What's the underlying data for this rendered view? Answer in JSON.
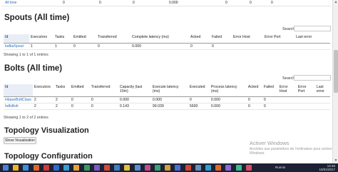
{
  "top_row": {
    "window": "All time",
    "c1": "0",
    "c2": "0",
    "c3": "0",
    "c4": "0.000",
    "c5": "0",
    "c6": "0",
    "c7": "0"
  },
  "spouts": {
    "title": "Spouts (All time)",
    "search_label": "Search:",
    "search_value": "",
    "columns": [
      "Id",
      "Executors",
      "Tasks",
      "Emitted",
      "Transferred",
      "Complete latency (ms)",
      "Acked",
      "Failed",
      "Error Host",
      "Error Port",
      "Last error"
    ],
    "rows": [
      [
        "kafkaSpout",
        "1",
        "1",
        "0",
        "0",
        "0.000",
        "0",
        "0",
        "",
        "",
        ""
      ]
    ],
    "info": "Showing 1 to 1 of 1 entries"
  },
  "bolts": {
    "title": "Bolts (All time)",
    "search_label": "Search:",
    "search_value": "",
    "columns": [
      "Id",
      "Executors",
      "Tasks",
      "Emitted",
      "Transferred",
      "Capacity (last 10m)",
      "Execute latency (ms)",
      "Executed",
      "Process latency (ms)",
      "Acked",
      "Failed",
      "Error Host",
      "Error Port",
      "Last error"
    ],
    "rows": [
      [
        "HbaseBoltClass",
        "2",
        "2",
        "0",
        "0",
        "0.000",
        "0.000",
        "0",
        "0.000",
        "0",
        "0",
        "",
        "",
        ""
      ],
      [
        "hdfsBolt",
        "2",
        "2",
        "0",
        "0",
        "0.143",
        "99.039",
        "5600",
        "0.000",
        "0",
        "0",
        "",
        "",
        ""
      ]
    ],
    "info": "Showing 1 to 2 of 2 entries"
  },
  "visualization": {
    "title": "Topology Visualization",
    "button": "Show Visualization"
  },
  "configuration": {
    "title": "Topology Configuration"
  },
  "watermark": {
    "line1": "Activer Windows",
    "line2": "Accédez aux paramètres de l'ordinateur pour activer Windows."
  },
  "taskbar": {
    "icon_colors": [
      "#4a7fd6",
      "#f0b429",
      "#3d8de0",
      "#e2672b",
      "#d23b3b",
      "#2d6bcf",
      "#3a9bd5",
      "#e8a33c",
      "#3c9a5f",
      "#7a5cc4",
      "#d84a3a",
      "#3b82c4",
      "#e0c33a",
      "#5a8fd6",
      "#c94b8a",
      "#3aa37a",
      "#d6a03a",
      "#4e6ed4",
      "#d0462f",
      "#6a8fb8",
      "#2f9fd1",
      "#e06a2b",
      "#8e6ad4",
      "#3dbd8a",
      "#d94e6a"
    ],
    "lang": "Runnin",
    "time": "14:46",
    "date": "10/01/2017"
  }
}
